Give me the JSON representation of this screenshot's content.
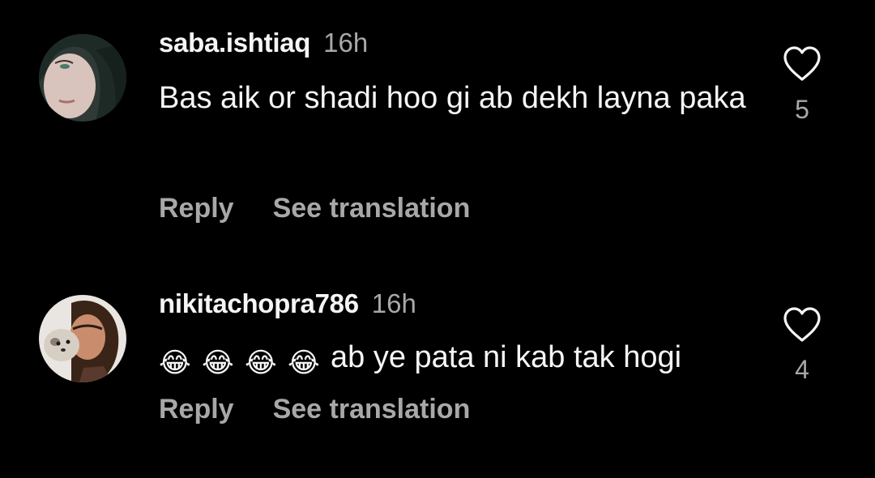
{
  "comments": [
    {
      "username": "saba.ishtiaq",
      "time": "16h",
      "text": "Bas aik or shadi hoo gi ab dekh layna paka",
      "reply_label": "Reply",
      "translate_label": "See translation",
      "like_count": "5",
      "like_icon": "heart-outline-icon",
      "avatar_colors": {
        "bg": "#2f3a36",
        "hair": "#1e2a25",
        "skin": "#d9c4bd"
      }
    },
    {
      "username": "nikitachopra786",
      "time": "16h",
      "emoji_prefix": [
        "😂",
        "😂",
        "😂",
        "😂"
      ],
      "text": "ab ye pata ni kab tak hogi",
      "reply_label": "Reply",
      "translate_label": "See translation",
      "like_count": "4",
      "like_icon": "heart-outline-icon",
      "avatar_colors": {
        "bg": "#e9e6e1",
        "hair": "#3a2418",
        "skin": "#c98d6d",
        "dog": "#d8cfc4"
      }
    }
  ],
  "colors": {
    "background": "#000000",
    "primary_text": "#f5f5f5",
    "secondary_text": "#a8a8a8"
  }
}
